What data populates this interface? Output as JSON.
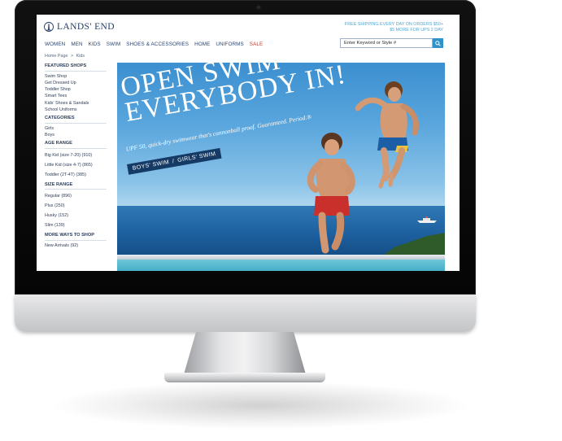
{
  "brand": {
    "name": "LANDS' END",
    "icon": "lighthouse-icon"
  },
  "nav": [
    {
      "label": "WOMEN"
    },
    {
      "label": "MEN"
    },
    {
      "label": "KIDS"
    },
    {
      "label": "SWIM"
    },
    {
      "label": "SHOES & ACCESSORIES"
    },
    {
      "label": "HOME"
    },
    {
      "label": "UNIFORMS"
    },
    {
      "label": "SALE",
      "color": "#c0392b"
    }
  ],
  "promo": {
    "line1": "FREE SHIPPING EVERY DAY ON ORDERS $50+",
    "line2": "$5 MORE FOR UPS 2 DAY"
  },
  "search": {
    "value": "Enter Keyword or Style #",
    "button_icon": "search-icon"
  },
  "breadcrumb": {
    "home": "Home Page",
    "separator": ">",
    "current": "Kids"
  },
  "sidebar": {
    "featured": {
      "heading": "FEATURED SHOPS",
      "items": [
        "Swim Shop",
        "Get Dressed Up",
        "Toddler Shop",
        "Smart Tees",
        "Kids' Shoes & Sandals",
        "School Uniforms"
      ]
    },
    "categories": {
      "heading": "CATEGORIES",
      "items": [
        "Girls",
        "Boys"
      ]
    },
    "age": {
      "heading": "AGE RANGE",
      "items": [
        "Big Kid (size 7-20) (910)",
        "Little Kid (size 4-7) (865)",
        "Toddler (2T-4T) (385)"
      ]
    },
    "size": {
      "heading": "SIZE RANGE",
      "items": [
        "Regular (896)",
        "Plus (250)",
        "Husky (152)",
        "Slim (139)"
      ]
    },
    "more": {
      "heading": "MORE WAYS TO SHOP",
      "items": [
        "New Arrivals (92)"
      ]
    }
  },
  "hero": {
    "title_line1": "OPEN SWIM",
    "title_line2": "EVERYBODY IN!",
    "tagline": "UPF 50, quick-dry swimwear that's cannonball proof. Guaranteed. Period.®",
    "cta_boys": "BOYS' SWIM",
    "cta_sep": "/",
    "cta_girls": "GIRLS' SWIM"
  },
  "colors": {
    "brand_navy": "#1e3a66",
    "accent_blue": "#4fa7d1",
    "sale_red": "#c0392b"
  }
}
